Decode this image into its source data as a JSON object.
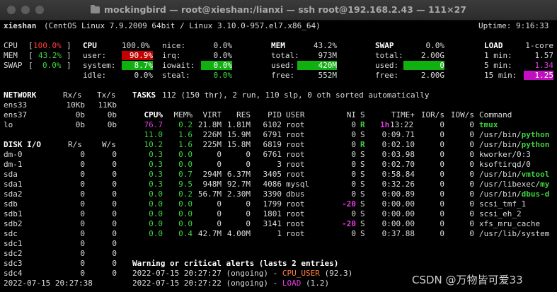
{
  "window": {
    "title": "mockingbird — root@xieshan:/lianxi — ssh root@192.168.2.43 — 111×27"
  },
  "header": {
    "host": "xieshan",
    "os": "(CentOS Linux 7.9.2009 64bit / Linux 3.10.0-957.el7.x86_64)",
    "uptime": "Uptime: 9:16:33"
  },
  "quicklook": {
    "cpu_label": "CPU",
    "cpu_val": "100.0%",
    "mem_label": "MEM",
    "mem_val": "43.2%",
    "swap_label": "SWAP",
    "swap_val": "0.0%"
  },
  "cpu": {
    "title": "CPU",
    "total": "100.0%",
    "user_label": "user:",
    "user": "90.9%",
    "system_label": "system:",
    "system": "8.7%",
    "idle_label": "idle:",
    "idle": "0.0%",
    "nice_label": "nice:",
    "nice": "0.0%",
    "irq_label": "irq:",
    "irq": "0.0%",
    "iowait_label": "iowait:",
    "iowait": "0.0%",
    "steal_label": "steal:",
    "steal": "0.0%"
  },
  "mem": {
    "title": "MEM",
    "pct": "43.2%",
    "total_label": "total:",
    "total": "973M",
    "used_label": "used:",
    "used": "420M",
    "free_label": "free:",
    "free": "552M"
  },
  "swap": {
    "title": "SWAP",
    "pct": "0.0%",
    "total_label": "total:",
    "total": "2.00G",
    "used_label": "used:",
    "used": "0",
    "free_label": "free:",
    "free": "2.00G"
  },
  "load": {
    "title": "LOAD",
    "cores": "1-core",
    "l1_label": "1 min:",
    "l1": "1.57",
    "l5_label": "5 min:",
    "l5": "1.34",
    "l15_label": "15 min:",
    "l15": "1.25"
  },
  "network": {
    "title": "NETWORK",
    "rx_label": "Rx/s",
    "tx_label": "Tx/s",
    "rows": [
      {
        "name": "ens33",
        "rx": "10Kb",
        "tx": "11Kb"
      },
      {
        "name": "ens37",
        "rx": "0b",
        "tx": "0b"
      },
      {
        "name": "lo",
        "rx": "0b",
        "tx": "0b"
      }
    ]
  },
  "disk": {
    "title": "DISK I/O",
    "r_label": "R/s",
    "w_label": "W/s",
    "rows": [
      {
        "name": "dm-0",
        "r": "0",
        "w": "0"
      },
      {
        "name": "dm-1",
        "r": "0",
        "w": "0"
      },
      {
        "name": "sda",
        "r": "0",
        "w": "0"
      },
      {
        "name": "sda1",
        "r": "0",
        "w": "0"
      },
      {
        "name": "sda2",
        "r": "0",
        "w": "0"
      },
      {
        "name": "sdb",
        "r": "0",
        "w": "0"
      },
      {
        "name": "sdb1",
        "r": "0",
        "w": "0"
      },
      {
        "name": "sdb2",
        "r": "0",
        "w": "0"
      },
      {
        "name": "sdc",
        "r": "0",
        "w": "0"
      },
      {
        "name": "sdc1",
        "r": "0",
        "w": "0"
      },
      {
        "name": "sdc2",
        "r": "0",
        "w": "0"
      },
      {
        "name": "sdc3",
        "r": "0",
        "w": "0"
      },
      {
        "name": "sdc4",
        "r": "0",
        "w": "0"
      }
    ]
  },
  "datetime": "2022-07-15 20:27:38",
  "tasks": {
    "label": "TASKS",
    "summary": "112 (150 thr), 2 run, 110 slp, 0 oth sorted automatically"
  },
  "proc": {
    "headers": {
      "cpu": "CPU%",
      "mem": "MEM%",
      "virt": "VIRT",
      "res": "RES",
      "pid": "PID",
      "user": "USER",
      "ni": "NI",
      "s": "S",
      "time": "TIME+",
      "ior": "IOR/s",
      "iow": "IOW/s",
      "cmd": "Command"
    },
    "rows": [
      {
        "cpu": "76.7",
        "mem": "0.2",
        "virt": "21.8M",
        "res": "1.81M",
        "pid": "6102",
        "user": "root",
        "ni": "0",
        "s": "R",
        "time_h": "1h",
        "time": "13:22",
        "ior": "0",
        "iow": "0",
        "cmd": "tmux",
        "cmd_rest": ""
      },
      {
        "cpu": "11.0",
        "mem": "1.6",
        "virt": "226M",
        "res": "15.9M",
        "pid": "6791",
        "user": "root",
        "ni": "0",
        "s": "S",
        "time_h": "",
        "time": "0:09.71",
        "ior": "0",
        "iow": "0",
        "cmd": "/usr/bin/",
        "cmd_rest": "python"
      },
      {
        "cpu": "10.2",
        "mem": "1.6",
        "virt": "225M",
        "res": "15.8M",
        "pid": "6819",
        "user": "root",
        "ni": "0",
        "s": "R",
        "time_h": "",
        "time": "0:02.10",
        "ior": "0",
        "iow": "0",
        "cmd": "/usr/bin/",
        "cmd_rest": "python"
      },
      {
        "cpu": "0.3",
        "mem": "0.0",
        "virt": "0",
        "res": "0",
        "pid": "6761",
        "user": "root",
        "ni": "0",
        "s": "S",
        "time_h": "",
        "time": "0:03.98",
        "ior": "0",
        "iow": "0",
        "cmd": "kworker/0:3",
        "cmd_rest": ""
      },
      {
        "cpu": "0.3",
        "mem": "0.0",
        "virt": "0",
        "res": "0",
        "pid": "3",
        "user": "root",
        "ni": "0",
        "s": "S",
        "time_h": "",
        "time": "0:02.70",
        "ior": "0",
        "iow": "0",
        "cmd": "ksoftirqd/0",
        "cmd_rest": ""
      },
      {
        "cpu": "0.3",
        "mem": "0.7",
        "virt": "294M",
        "res": "6.37M",
        "pid": "3405",
        "user": "root",
        "ni": "0",
        "s": "S",
        "time_h": "",
        "time": "0:58.84",
        "ior": "0",
        "iow": "0",
        "cmd": "/usr/bin/",
        "cmd_rest": "vmtool"
      },
      {
        "cpu": "0.3",
        "mem": "9.5",
        "virt": "948M",
        "res": "92.7M",
        "pid": "4086",
        "user": "mysql",
        "ni": "0",
        "s": "S",
        "time_h": "",
        "time": "0:32.26",
        "ior": "0",
        "iow": "0",
        "cmd": "/usr/libexec/",
        "cmd_rest": "my"
      },
      {
        "cpu": "0.0",
        "mem": "0.2",
        "virt": "56.7M",
        "res": "2.30M",
        "pid": "3390",
        "user": "dbus",
        "ni": "0",
        "s": "S",
        "time_h": "",
        "time": "0:00.89",
        "ior": "0",
        "iow": "0",
        "cmd": "/usr/bin/",
        "cmd_rest": "dbus-d"
      },
      {
        "cpu": "0.0",
        "mem": "0.0",
        "virt": "0",
        "res": "0",
        "pid": "1799",
        "user": "root",
        "ni": "-20",
        "s": "S",
        "time_h": "",
        "time": "0:00.00",
        "ior": "0",
        "iow": "0",
        "cmd": "scsi_tmf_1",
        "cmd_rest": ""
      },
      {
        "cpu": "0.0",
        "mem": "0.0",
        "virt": "0",
        "res": "0",
        "pid": "1801",
        "user": "root",
        "ni": "0",
        "s": "S",
        "time_h": "",
        "time": "0:00.00",
        "ior": "0",
        "iow": "0",
        "cmd": "scsi_eh_2",
        "cmd_rest": ""
      },
      {
        "cpu": "0.0",
        "mem": "0.0",
        "virt": "0",
        "res": "0",
        "pid": "3141",
        "user": "root",
        "ni": "-20",
        "s": "S",
        "time_h": "",
        "time": "0:00.00",
        "ior": "0",
        "iow": "0",
        "cmd": "xfs_mru_cache",
        "cmd_rest": ""
      },
      {
        "cpu": "0.0",
        "mem": "0.4",
        "virt": "42.7M",
        "res": "4.00M",
        "pid": "1",
        "user": "root",
        "ni": "0",
        "s": "S",
        "time_h": "",
        "time": "0:37.88",
        "ior": "0",
        "iow": "0",
        "cmd": "/usr/lib/system",
        "cmd_rest": ""
      }
    ]
  },
  "alerts": {
    "title": "Warning or critical alerts (lasts 2 entries)",
    "entries": [
      {
        "time": "2022-07-15 20:27:27 (ongoing) - ",
        "type": "CPU_USER",
        "value": " (92.3)"
      },
      {
        "time": "2022-07-15 20:27:22 (ongoing) - ",
        "type": "LOAD",
        "value": " (1.2)"
      }
    ]
  },
  "watermark": "CSDN @万物皆可爱33",
  "colors": {
    "background": "#000000",
    "green": "#3fd33f",
    "magenta": "#e03ce0",
    "red_bg": "#c40000",
    "green_bg": "#10b010",
    "magenta_bg": "#c010c0"
  }
}
